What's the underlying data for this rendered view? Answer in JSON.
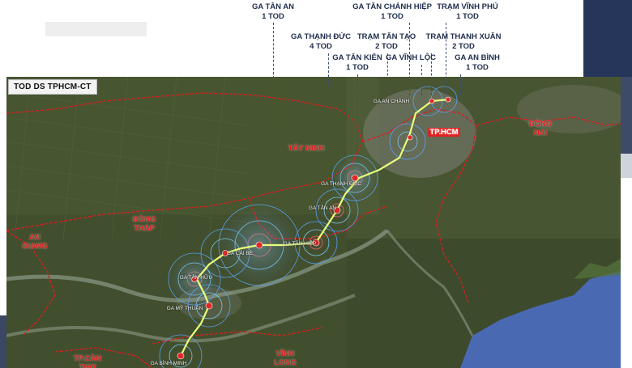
{
  "map_title": "TOD DS TPHCM-CT",
  "stations": [
    {
      "name": "GA TÂN AN",
      "tod": "1 TOD"
    },
    {
      "name": "GA TÂN CHÁNH HIỆP",
      "tod": "1 TOD"
    },
    {
      "name": "TRẠM VĨNH PHÚ",
      "tod": "1 TOD"
    },
    {
      "name": "GA THẠNH ĐỨC",
      "tod": "4 TOD"
    },
    {
      "name": "TRẠM TÂN TẠO",
      "tod": "2 TOD"
    },
    {
      "name": "TRẠM THANH XUÂN",
      "tod": "2 TOD"
    },
    {
      "name": "GA TÂN KIÊN",
      "tod": "1 TOD"
    },
    {
      "name": "GA VĨNH LỘC",
      "tod": ""
    },
    {
      "name": "GA AN BÌNH",
      "tod": "1 TOD"
    }
  ],
  "provinces": [
    "TÂY NINH",
    "TP.HCM",
    "ĐỒNG NAI",
    "ĐỒNG THÁP",
    "AN GIANG",
    "VĨNH LONG",
    "TP.CẦN THƠ"
  ],
  "map_station_labels": [
    "GA THẠNH ĐỨC",
    "GA TÂN AN",
    "GA CÁI BÈ",
    "GA TÂN HIỆP",
    "GA MỸ THUẬN",
    "GA TÂN HỮU",
    "GA BÌNH MINH",
    "GA AN CHÁNH"
  ],
  "colors": {
    "rail_line": "#e9ff7a",
    "boundary": "#d42020",
    "label_text": "#1f2e4d",
    "sea": "#4a69b3",
    "header_block": "#26365a"
  }
}
